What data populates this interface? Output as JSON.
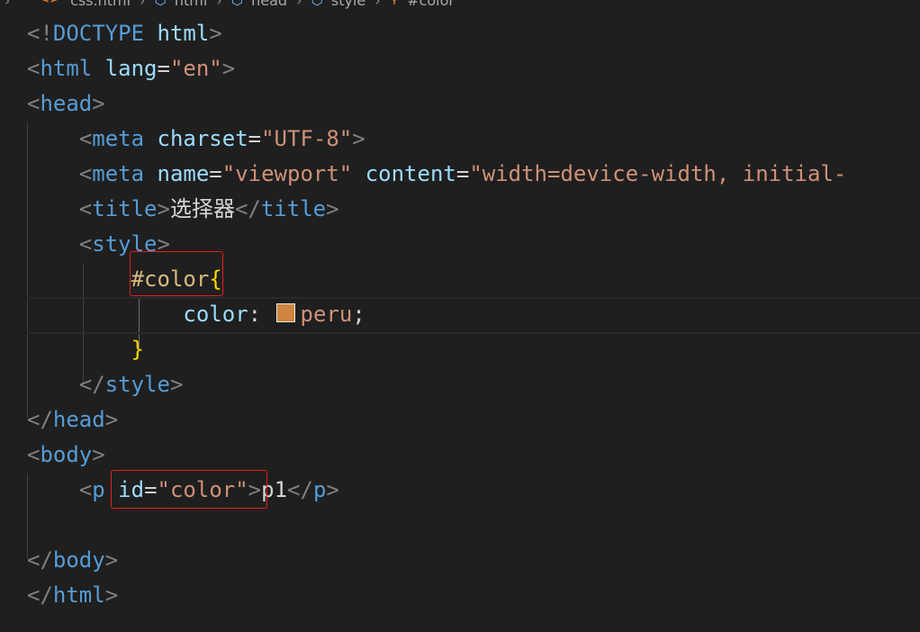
{
  "breadcrumb": {
    "file": "css.html",
    "items": [
      "html",
      "head",
      "style",
      "#color"
    ]
  },
  "code": {
    "doctype_prefix": "<!",
    "doctype_kw": "DOCTYPE",
    "doctype_html": "html",
    "html_tag": "html",
    "lang_attr": "lang",
    "lang_val": "\"en\"",
    "head_tag": "head",
    "meta_tag": "meta",
    "charset_attr": "charset",
    "charset_val": "\"UTF-8\"",
    "name_attr": "name",
    "name_val": "\"viewport\"",
    "content_attr": "content",
    "content_val": "\"width=device-width, initial-",
    "title_tag": "title",
    "title_text": "选择器",
    "style_tag": "style",
    "selector": "#color",
    "brace_open": "{",
    "brace_close": "}",
    "css_prop": "color",
    "css_colon": ":",
    "css_value": "peru",
    "css_semicolon": ";",
    "body_tag": "body",
    "p_tag": "p",
    "id_attr": "id",
    "id_val": "\"color\"",
    "p_text": "p1"
  },
  "colors": {
    "swatch": "#cd853f",
    "highlight_box": "#e51e1e"
  }
}
